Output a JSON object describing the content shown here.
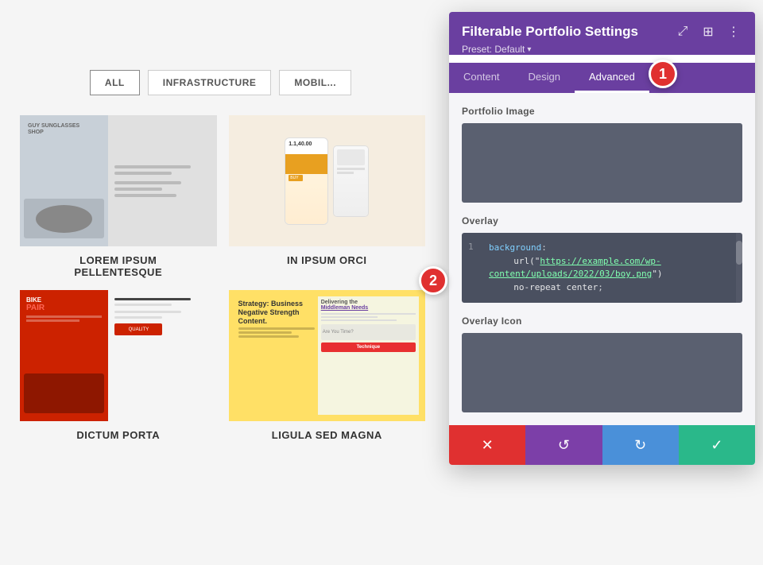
{
  "panel": {
    "title": "Filterable Portfolio Settings",
    "preset_label": "Preset: Default",
    "preset_arrow": "▾",
    "tabs": [
      {
        "id": "content",
        "label": "Content",
        "active": false
      },
      {
        "id": "design",
        "label": "Design",
        "active": false
      },
      {
        "id": "advanced",
        "label": "Advanced",
        "active": true
      }
    ],
    "badge_count": "1",
    "header_icons": {
      "expand": "⤢",
      "columns": "⋮⋮",
      "more": "⋮"
    }
  },
  "sections": {
    "portfolio_image": {
      "label": "Portfolio Image"
    },
    "overlay": {
      "label": "Overlay",
      "code_lines": [
        {
          "num": "1",
          "key": "background",
          "rest": ": url(\"https://example.com/wp-content/uploads/2022/03/boy.png\") no-repeat center;"
        }
      ]
    },
    "overlay_icon": {
      "label": "Overlay Icon"
    }
  },
  "toolbar": {
    "cancel_icon": "✕",
    "undo_icon": "↺",
    "redo_icon": "↻",
    "save_icon": "✓"
  },
  "filter": {
    "buttons": [
      "ALL",
      "INFRASTRUCTURE",
      "MOBIL..."
    ]
  },
  "portfolio_items": [
    {
      "title": "LOREM IPSUM\nPELLENTESQUE",
      "thumb": "1"
    },
    {
      "title": "IN IPSUM ORCI",
      "thumb": "2"
    },
    {
      "title": "DICTUM PORTA",
      "thumb": "3"
    },
    {
      "title": "LIGULA SED MAGNA",
      "thumb": "4"
    }
  ],
  "badges": {
    "badge1": "1",
    "badge2": "2"
  }
}
